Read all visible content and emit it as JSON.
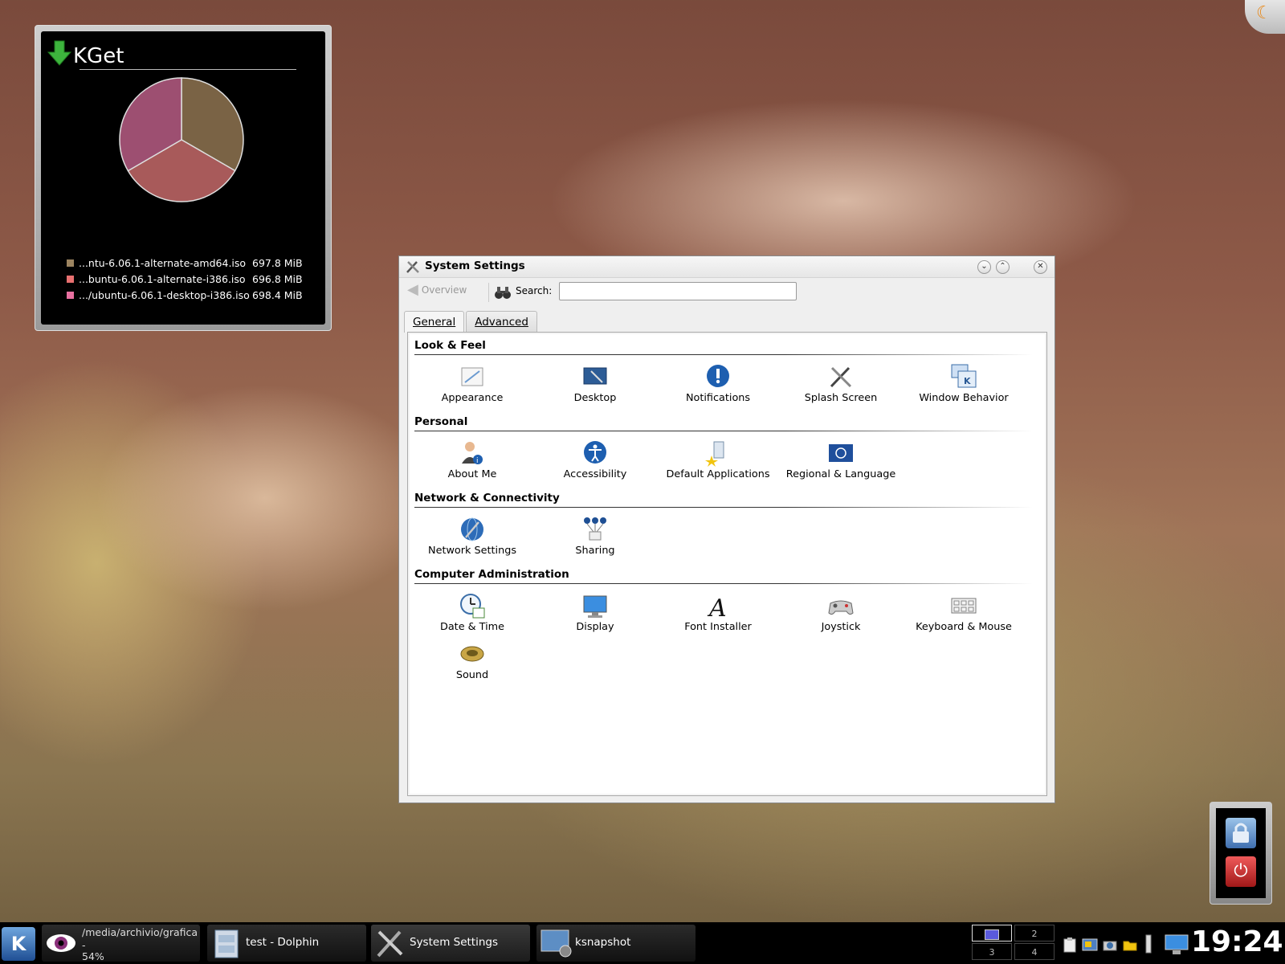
{
  "kget": {
    "title": "KGet",
    "items": [
      {
        "name": "...ntu-6.06.1-alternate-amd64.iso",
        "size": "697.8 MiB",
        "color": "#9c8460"
      },
      {
        "name": "...buntu-6.06.1-alternate-i386.iso",
        "size": "696.8 MiB",
        "color": "#e87070"
      },
      {
        "name": ".../ubuntu-6.06.1-desktop-i386.iso",
        "size": "698.4 MiB",
        "color": "#e870a0"
      }
    ],
    "pie_colors": [
      "#7a6345",
      "#a85a5a",
      "#9d4f71"
    ]
  },
  "window": {
    "title": "System Settings",
    "overview_label": "Overview",
    "search_label": "Search:",
    "search_value": "",
    "tabs": [
      "General",
      "Advanced"
    ],
    "sections": [
      {
        "title": "Look & Feel",
        "items": [
          "Appearance",
          "Desktop",
          "Notifications",
          "Splash Screen",
          "Window Behavior"
        ]
      },
      {
        "title": "Personal",
        "items": [
          "About Me",
          "Accessibility",
          "Default Applications",
          "Regional & Language"
        ]
      },
      {
        "title": "Network & Connectivity",
        "items": [
          "Network Settings",
          "Sharing"
        ]
      },
      {
        "title": "Computer Administration",
        "items": [
          "Date & Time",
          "Display",
          "Font Installer",
          "Joystick",
          "Keyboard & Mouse",
          "Sound"
        ]
      }
    ]
  },
  "taskbar": {
    "tasks": [
      {
        "label": "/media/archivio/grafica",
        "sub1": "-",
        "sub2": "54%"
      },
      {
        "label": "test - Dolphin"
      },
      {
        "label": "System Settings"
      },
      {
        "label": "ksnapshot"
      }
    ],
    "pager": [
      "1",
      "2",
      "3",
      "4"
    ],
    "clock": "19:24"
  }
}
